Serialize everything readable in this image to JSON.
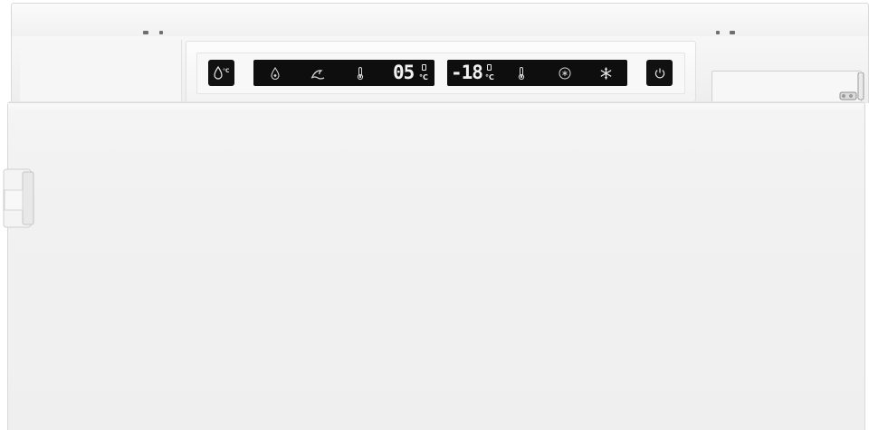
{
  "appliance": {
    "type": "refrigerator-freezer",
    "color": "#f1f1f1"
  },
  "control_panel": {
    "fridge_display": {
      "temperature": "05",
      "unit": "°C",
      "icons": [
        "drop-icon",
        "holiday-icon",
        "thermometer-icon"
      ]
    },
    "freezer_display": {
      "temperature": "-18",
      "unit": "°C",
      "icons": [
        "thermometer-icon",
        "fast-freeze-icon",
        "snowflake-icon"
      ]
    },
    "left_button": {
      "icon": "drop-celsius-icon",
      "unit": "°C"
    },
    "right_button": {
      "icon": "power-icon"
    },
    "display_color": "#0e0e0e",
    "segment_color": "#f2f2f2"
  }
}
